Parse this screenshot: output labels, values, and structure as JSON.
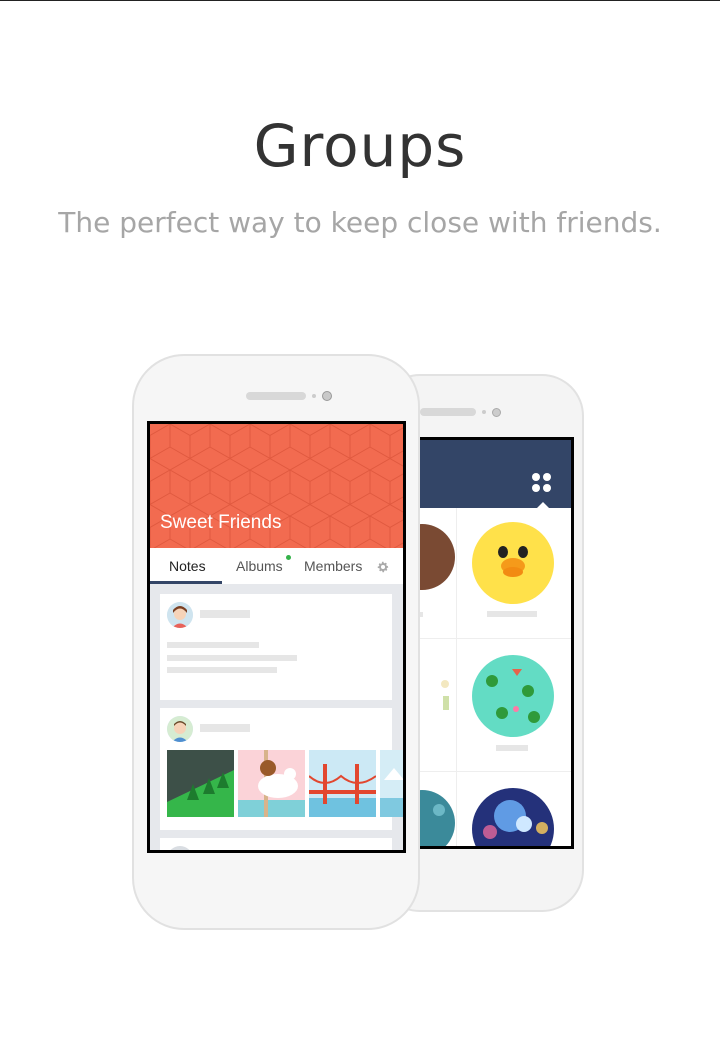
{
  "page": {
    "title": "Groups",
    "subtitle": "The perfect way to keep close with friends."
  },
  "group": {
    "name": "Sweet Friends",
    "tabs": [
      {
        "label": "Notes",
        "active": true
      },
      {
        "label": "Albums",
        "active": false,
        "has_new": true
      },
      {
        "label": "Members",
        "active": false
      }
    ]
  },
  "colors": {
    "cover": "#f26b50",
    "header": "#334567",
    "accent_dot": "#34b24a"
  },
  "icons": [
    "grid-menu-icon",
    "settings-gear-icon",
    "user-avatar-icon"
  ]
}
